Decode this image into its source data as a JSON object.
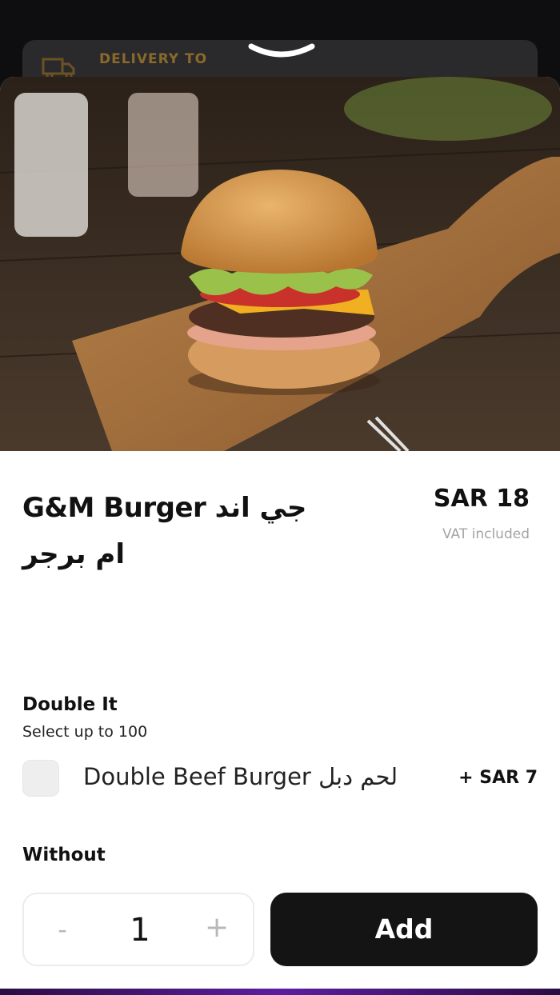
{
  "background": {
    "delivery_label": "DELIVERY TO"
  },
  "product": {
    "title": "G&M Burger جي اند ام برجر",
    "price": "SAR 18",
    "vat_note": "VAT included"
  },
  "sections": [
    {
      "title": "Double It",
      "subtitle": "Select up to 100",
      "options": [
        {
          "label": "Double Beef Burger لحم دبل",
          "price": "+  SAR 7",
          "checked": false
        }
      ]
    },
    {
      "title": "Without"
    }
  ],
  "footer": {
    "quantity": "1",
    "minus_symbol": "-",
    "plus_symbol": "+",
    "add_label": "Add"
  },
  "icons": {
    "delivery": "delivery-truck-icon",
    "handle": "chevron-down-icon",
    "checkbox": "checkbox-icon"
  },
  "colors": {
    "backdrop": "#0e0e10",
    "accent_dark": "#151414",
    "muted": "#a4a4a8",
    "delivery_label": "#8a6a2a"
  }
}
